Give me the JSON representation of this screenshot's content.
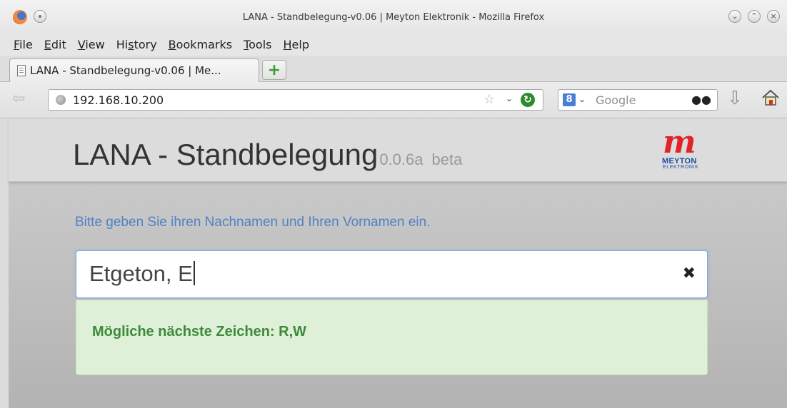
{
  "window": {
    "title": "LANA - Standbelegung-v0.06 | Meyton Elektronik - Mozilla Firefox",
    "controls": [
      "⌄",
      "⌃",
      "×"
    ]
  },
  "menu": {
    "items": [
      {
        "key": "F",
        "rest": "ile"
      },
      {
        "key": "E",
        "rest": "dit"
      },
      {
        "key": "V",
        "rest": "iew"
      },
      {
        "pre": "Hi",
        "key": "s",
        "rest": "tory"
      },
      {
        "key": "B",
        "rest": "ookmarks"
      },
      {
        "key": "T",
        "rest": "ools"
      },
      {
        "key": "H",
        "rest": "elp"
      }
    ]
  },
  "tab": {
    "label": "LANA - Standbelegung-v0.06 | Me..."
  },
  "newtab": {
    "symbol": "+"
  },
  "nav": {
    "url": "192.168.10.200",
    "search_placeholder": "Google",
    "search_engine_glyph": "8"
  },
  "page": {
    "title": "LANA - Standbelegung",
    "version": "0.0.6a",
    "beta": "beta",
    "logo": {
      "name": "MEYTON",
      "sub": "ELEKTRONIK"
    },
    "instruction": "Bitte geben Sie ihren Nachnamen und Ihren Vornamen ein.",
    "name_input_value": "Etgeton, E",
    "clear_symbol": "✖",
    "hint": "Mögliche nächste Zeichen: R,W"
  },
  "colors": {
    "instruction": "#4e82c3",
    "hint_text": "#3c8a3a",
    "hint_bg": "#dff0d8",
    "logo_red": "#e0242a",
    "logo_blue": "#1f4ea3"
  }
}
